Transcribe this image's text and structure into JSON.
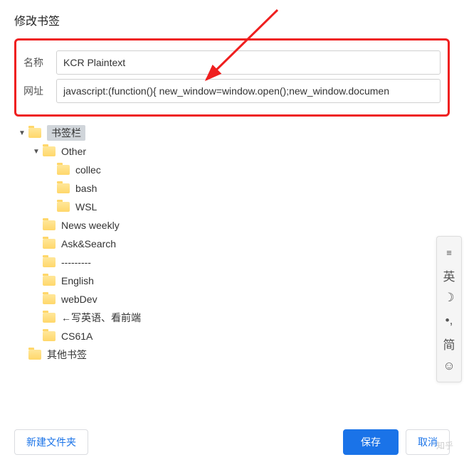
{
  "dialog": {
    "title": "修改书签",
    "name_label": "名称",
    "url_label": "网址",
    "name_value": "KCR Plaintext",
    "url_value": "javascript:(function(){ new_window=window.open();new_window.documen"
  },
  "tree": [
    {
      "level": 0,
      "expanded": true,
      "label": "书签栏",
      "selected": true
    },
    {
      "level": 1,
      "expanded": true,
      "label": "Other"
    },
    {
      "level": 2,
      "expanded": null,
      "label": "collec"
    },
    {
      "level": 2,
      "expanded": null,
      "label": "bash"
    },
    {
      "level": 2,
      "expanded": null,
      "label": "WSL"
    },
    {
      "level": 1,
      "expanded": null,
      "label": "News weekly"
    },
    {
      "level": 1,
      "expanded": null,
      "label": "Ask&Search"
    },
    {
      "level": 1,
      "expanded": null,
      "label": "---------"
    },
    {
      "level": 1,
      "expanded": null,
      "label": "English"
    },
    {
      "level": 1,
      "expanded": null,
      "label": "webDev"
    },
    {
      "level": 1,
      "expanded": null,
      "label": "←写英语、看前端"
    },
    {
      "level": 1,
      "expanded": null,
      "label": "CS61A"
    },
    {
      "level": 0,
      "expanded": null,
      "label": "其他书签"
    }
  ],
  "footer": {
    "new_folder": "新建文件夹",
    "save": "保存",
    "cancel": "取消"
  },
  "ime": {
    "items": [
      "≡",
      "英",
      "☽",
      "•,",
      "简",
      "☺"
    ]
  },
  "watermark": "知乎"
}
